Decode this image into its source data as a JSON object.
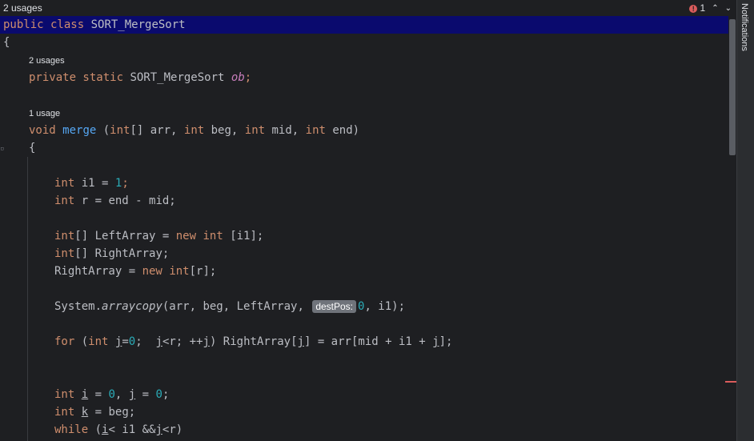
{
  "top": {
    "usages": "2 usages",
    "error_count": "1",
    "prev_label": "⌃",
    "next_label": "⌄"
  },
  "code": {
    "class_decl": {
      "kw": "public class",
      "name": "SORT_MergeSort"
    },
    "open_brace": "{",
    "hint_field": "2 usages",
    "field_decl": {
      "kw": "private static",
      "type": "SORT_MergeSort",
      "name": "ob",
      "semi": ";"
    },
    "hint_method": "1 usage",
    "method_decl": {
      "kw1": "void",
      "name": "merge",
      "p1": " (",
      "t1": "int",
      "r1": "[] arr, ",
      "t2": "int",
      "r2": " beg, ",
      "t3": "int",
      "r3": " mid, ",
      "t4": "int",
      "r4": " end)"
    },
    "method_open": "{",
    "l1": {
      "kw": "int",
      "a": " i1 = ",
      "n": "1",
      "b": ";"
    },
    "l2": {
      "kw": "int",
      "a": " r = end - mid;"
    },
    "l3": {
      "kw": "int",
      "a": "[] LeftArray = ",
      "kw2": "new",
      "kw3": "int",
      "b": " [i1];"
    },
    "l4": {
      "kw": "int",
      "a": "[] RightArray;"
    },
    "l5": {
      "a": "RightArray = ",
      "kw": "new",
      "kw2": "int",
      "b": "[r];"
    },
    "l6": {
      "a": "System.",
      "m": "arraycopy",
      "b": "(arr, beg, LeftArray, ",
      "hint": "destPos:",
      "n": "0",
      "c": ", i1);"
    },
    "l7": {
      "kw": "for",
      "a": " (",
      "kw2": "int",
      "v": "j",
      "b": "=",
      "n": "0",
      "c": ";  ",
      "v2": "j",
      "d": "<r; ++",
      "v3": "j",
      "e": ") RightArray[",
      "v4": "j",
      "f": "] = arr[mid + i1 + ",
      "v5": "j",
      "g": "];"
    },
    "l8": {
      "kw": "int",
      "a": " ",
      "v": "i",
      "b": " = ",
      "n": "0",
      "c": ", ",
      "v2": "j",
      "d": " = ",
      "n2": "0",
      "e": ";"
    },
    "l9": {
      "kw": "int",
      "a": " ",
      "v": "k",
      "b": " = beg;"
    },
    "l10": {
      "kw": "while",
      "a": " (",
      "v": "i",
      "b": "< i1 &&",
      "v2": "j",
      "c": "<r)"
    }
  },
  "sidebar": {
    "notifications": "Notifications"
  },
  "colors": {
    "keyword": "#cf8e6d",
    "number": "#2aacb8",
    "field": "#c77dbb",
    "highlight": "#0a0a6e",
    "error": "#db5c5c"
  }
}
